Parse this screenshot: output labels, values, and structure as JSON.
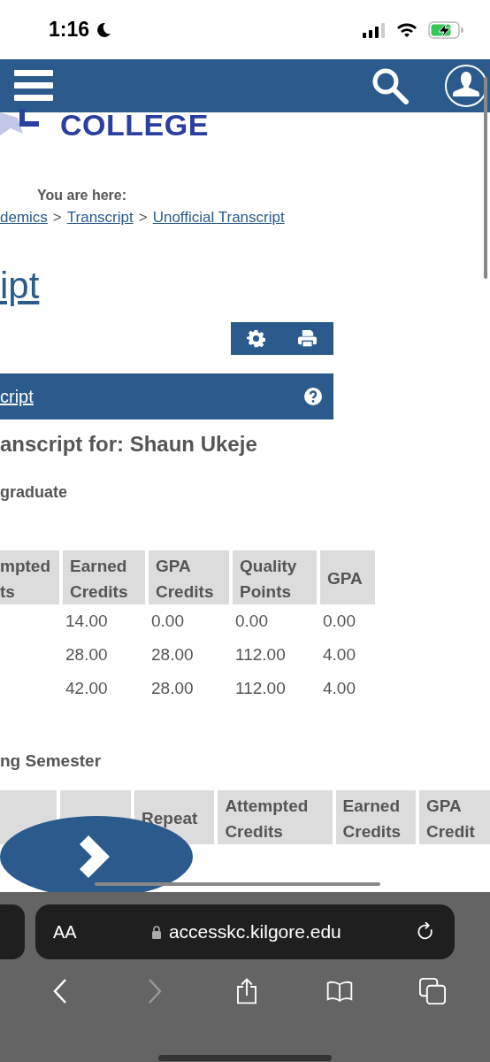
{
  "status_bar": {
    "time": "1:16"
  },
  "logo": {
    "text": "COLLEGE"
  },
  "breadcrumb": {
    "label": "You are here:",
    "separator": ">",
    "links": [
      "demics",
      "Transcript",
      "Unofficial Transcript"
    ]
  },
  "page_title": "ipt",
  "panel": {
    "title": "cript"
  },
  "student_heading": "anscript for: Shaun Ukeje",
  "level_heading": "graduate",
  "summary_table": {
    "columns": [
      "mpted ts",
      "Earned Credits",
      "GPA Credits",
      "Quality Points",
      "GPA"
    ],
    "rows": [
      {
        "cells": [
          "",
          "14.00",
          "0.00",
          "0.00",
          "0.00"
        ]
      },
      {
        "cells": [
          "",
          "28.00",
          "28.00",
          "112.00",
          "4.00"
        ]
      },
      {
        "cells": [
          "",
          "42.00",
          "28.00",
          "112.00",
          "4.00"
        ]
      }
    ]
  },
  "semester_heading": "ng Semester",
  "semester_table": {
    "columns": [
      "Repeat",
      "Attempted Credits",
      "Earned Credits",
      "GPA Credit"
    ]
  },
  "browser": {
    "text_size": "AA",
    "url": "accesskc.kilgore.edu",
    "forward_disabled": true
  }
}
